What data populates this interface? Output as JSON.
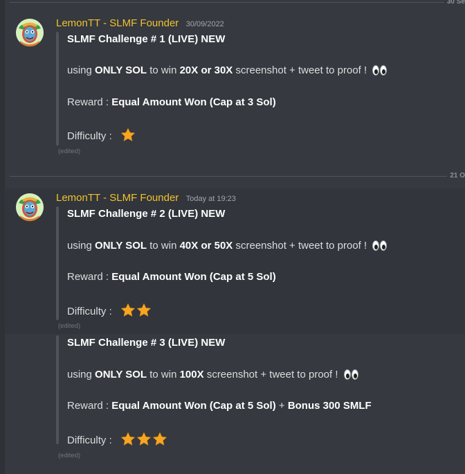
{
  "dividers": [
    {
      "label": "30 Se"
    },
    {
      "label": "21 O"
    }
  ],
  "messages": [
    {
      "author": "LemonTT - SLMF Founder",
      "timestamp": "30/09/2022",
      "title": "SLMF Challenge # 1 (LIVE) NEW",
      "using_pre": "using",
      "using_b1": "ONLY SOL",
      "using_mid": "to win",
      "using_b2": "20X or 30X",
      "using_post": "screenshot + tweet to proof !",
      "reward_label": "Reward :",
      "reward_value": "Equal Amount Won (Cap at 3 Sol)",
      "difficulty_label": "Difficulty :",
      "stars": 1,
      "edited": "(edited)"
    },
    {
      "author": "LemonTT - SLMF Founder",
      "timestamp": "Today at 19:23",
      "title": "SLMF Challenge # 2 (LIVE) NEW",
      "using_pre": "using",
      "using_b1": "ONLY SOL",
      "using_mid": "to win",
      "using_b2": "40X or 50X",
      "using_post": "screenshot + tweet to proof !",
      "reward_label": "Reward :",
      "reward_value": "Equal Amount Won (Cap at 5 Sol)",
      "difficulty_label": "Difficulty :",
      "stars": 2,
      "edited": "(edited)"
    },
    {
      "title": "SLMF Challenge # 3 (LIVE) NEW",
      "using_pre": "using",
      "using_b1": "ONLY SOL",
      "using_mid": "to win",
      "using_b2": "100X",
      "using_post": "screenshot + tweet to proof !",
      "reward_label": "Reward :",
      "reward_value": "Equal Amount Won (Cap at 5 Sol)",
      "reward_plus": "+",
      "reward_bonus": "Bonus 300 SMLF",
      "difficulty_label": "Difficulty :",
      "stars": 3,
      "edited": "(edited)"
    }
  ],
  "colors": {
    "username": "#f0c230",
    "star": "#f5a623",
    "background": "#36393f"
  },
  "icons": {
    "eyes": "eyes-emoji",
    "star": "star-emoji"
  }
}
